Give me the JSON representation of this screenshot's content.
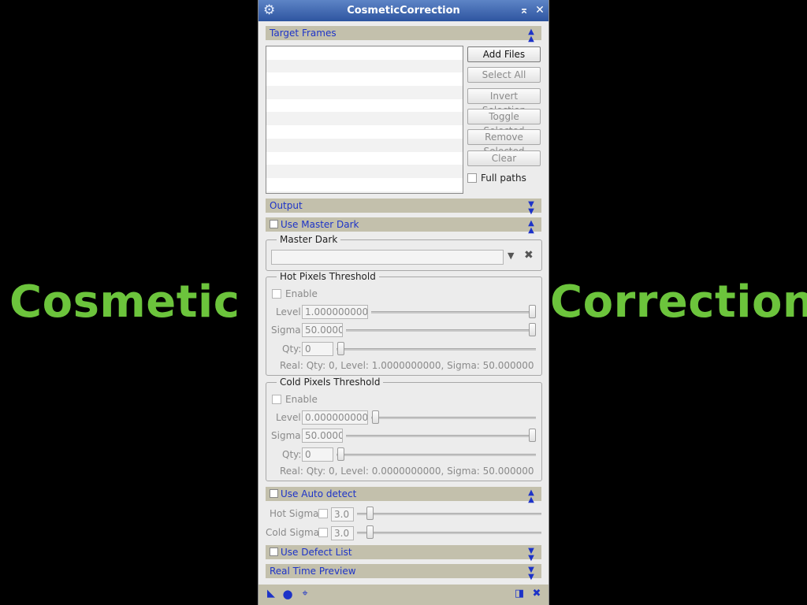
{
  "side_text": {
    "left": "Cosmetic",
    "right": "Correction"
  },
  "window": {
    "title": "CosmeticCorrection",
    "icons": {
      "app": "gear-icon",
      "shade": "collapse-icon",
      "close": "close-icon"
    }
  },
  "sections": {
    "target_frames": "Target Frames",
    "output": "Output",
    "use_master_dark": "Use Master Dark",
    "use_auto_detect": "Use Auto detect",
    "use_defect_list": "Use Defect List",
    "real_time_preview": "Real Time Preview"
  },
  "target_frames": {
    "buttons": {
      "add_files": "Add Files",
      "select_all": "Select All",
      "invert_selection": "Invert Selection",
      "toggle_selected": "Toggle Selected",
      "remove_selected": "Remove Selected",
      "clear": "Clear"
    },
    "full_paths_label": "Full paths"
  },
  "master_dark": {
    "group_title": "Master Dark",
    "path_value": "",
    "icons": {
      "dropdown": "chevron-down-icon",
      "clear": "clear-icon"
    }
  },
  "hot_pixels": {
    "group_title": "Hot Pixels Threshold",
    "enable_label": "Enable",
    "level_label": "Level:",
    "level_value": "1.0000000000",
    "level_position": 1.0,
    "sigma_label": "Sigma:",
    "sigma_value": "50.0000",
    "sigma_position": 1.0,
    "qty_label": "Qty:",
    "qty_value": "0",
    "qty_position": 0.0,
    "real_text": "Real: Qty: 0, Level: 1.0000000000, Sigma: 50.000000"
  },
  "cold_pixels": {
    "group_title": "Cold Pixels Threshold",
    "enable_label": "Enable",
    "level_label": "Level:",
    "level_value": "0.0000000000",
    "level_position": 0.0,
    "sigma_label": "Sigma:",
    "sigma_value": "50.0000",
    "sigma_position": 1.0,
    "qty_label": "Qty:",
    "qty_value": "0",
    "qty_position": 0.0,
    "real_text": "Real: Qty: 0, Level: 0.0000000000, Sigma: 50.000000"
  },
  "auto_detect": {
    "hot_sigma_label": "Hot Sigma:",
    "hot_sigma_value": "3.0",
    "cold_sigma_label": "Cold Sigma:",
    "cold_sigma_value": "3.0"
  },
  "bottom_bar": {
    "icons": [
      "new-instance-icon",
      "execute-global-icon",
      "apply-icon",
      "edit-instance-icon",
      "reset-icon"
    ]
  },
  "colors": {
    "accent": "#1d33c8",
    "section_bar": "#c3c0ac",
    "title_bar": "#3a62ae",
    "side_text": "#6cc43c"
  }
}
